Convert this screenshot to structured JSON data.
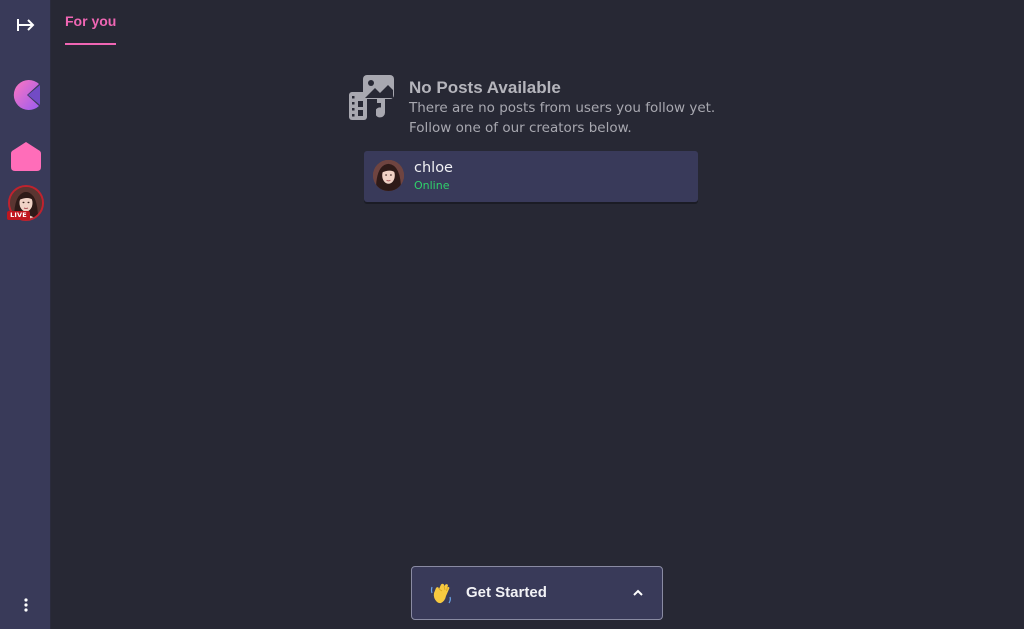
{
  "sidebar": {
    "expand_icon": "expand-sidebar-icon",
    "logo_icon": "app-logo-icon",
    "home_icon": "home-icon",
    "live_badge": "LIVE",
    "more_icon": "more-vertical-icon"
  },
  "tabs": [
    {
      "label": "For you",
      "active": true
    }
  ],
  "empty_state": {
    "icon": "media-collage-icon",
    "title": "No Posts Available",
    "description": "There are no posts from users you follow yet. Follow one of our creators below."
  },
  "creators": [
    {
      "name": "chloe",
      "status": "Online",
      "status_color": "#2fd26b"
    }
  ],
  "get_started": {
    "emoji": "waving-hand-icon",
    "label": "Get Started",
    "chevron": "chevron-up-icon"
  },
  "colors": {
    "background": "#272834",
    "sidebar": "#393a59",
    "accent_pink": "#f066b4",
    "card": "#393a5a",
    "online_green": "#2fd26b",
    "live_red": "#c0161f"
  }
}
